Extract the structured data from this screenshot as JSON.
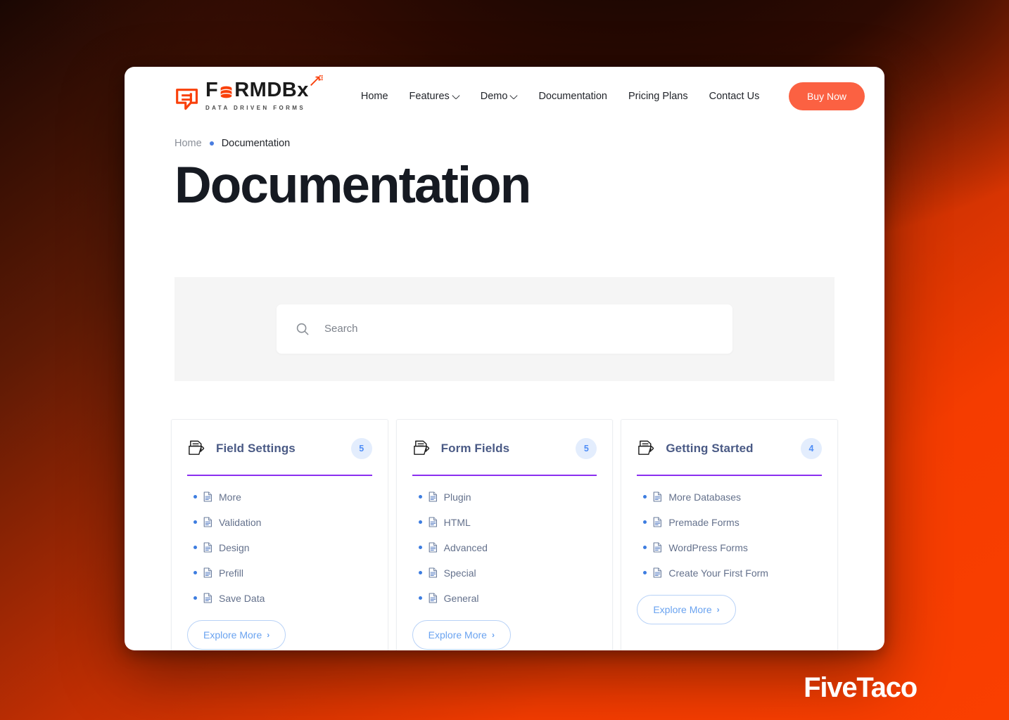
{
  "brand": {
    "name_prefix": "F",
    "name_suffix": "RMDBx",
    "tagline": "DATA DRIVEN FORMS",
    "accent_color": "#fb6142",
    "logo_icon": "formdbx-logo-icon"
  },
  "nav": {
    "items": [
      {
        "label": "Home",
        "has_caret": false
      },
      {
        "label": "Features",
        "has_caret": true
      },
      {
        "label": "Demo",
        "has_caret": true
      },
      {
        "label": "Documentation",
        "has_caret": false
      },
      {
        "label": "Pricing Plans",
        "has_caret": false
      },
      {
        "label": "Contact Us",
        "has_caret": false
      }
    ],
    "cta": {
      "label": "Buy Now"
    }
  },
  "breadcrumb": {
    "home": "Home",
    "current": "Documentation",
    "separator_color": "#4a7de0"
  },
  "page": {
    "title": "Documentation"
  },
  "search": {
    "placeholder": "Search",
    "value": "",
    "icon": "search-icon"
  },
  "cards": [
    {
      "title": "Field Settings",
      "count": "5",
      "icon": "folder-document-icon",
      "accent_color": "#8b2ff0",
      "items": [
        "More",
        "Validation",
        "Design",
        "Prefill",
        "Save Data"
      ],
      "explore_label": "Explore More",
      "explore_chevron": "›"
    },
    {
      "title": "Form Fields",
      "count": "5",
      "icon": "folder-document-icon",
      "accent_color": "#8b2ff0",
      "items": [
        "Plugin",
        "HTML",
        "Advanced",
        "Special",
        "General"
      ],
      "explore_label": "Explore More",
      "explore_chevron": "›"
    },
    {
      "title": "Getting Started",
      "count": "4",
      "icon": "folder-document-icon",
      "accent_color": "#8b2ff0",
      "items": [
        "More Databases",
        "Premade Forms",
        "WordPress Forms",
        "Create Your First Form"
      ],
      "explore_label": "Explore More",
      "explore_chevron": "›"
    }
  ],
  "watermark": {
    "text": "FiveTaco"
  }
}
